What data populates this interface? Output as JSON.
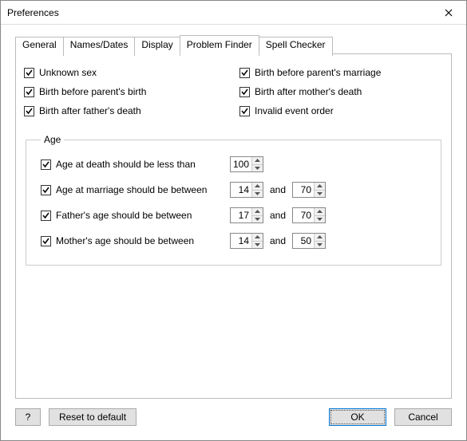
{
  "window": {
    "title": "Preferences"
  },
  "tabs": {
    "general": "General",
    "names_dates": "Names/Dates",
    "display": "Display",
    "problem_finder": "Problem Finder",
    "spell_checker": "Spell Checker"
  },
  "checks": {
    "unknown_sex": "Unknown sex",
    "birth_before_marriage": "Birth before parent's marriage",
    "birth_before_parents_birth": "Birth before parent's birth",
    "birth_after_mothers_death": "Birth after mother's death",
    "birth_after_fathers_death": "Birth after father's death",
    "invalid_event_order": "Invalid event order"
  },
  "age": {
    "legend": "Age",
    "death_label": "Age at death should be less than",
    "death_value": "100",
    "marriage_label": "Age at marriage should be between",
    "marriage_min": "14",
    "marriage_max": "70",
    "father_label": "Father's age should be between",
    "father_min": "17",
    "father_max": "70",
    "mother_label": "Mother's age should be between",
    "mother_min": "14",
    "mother_max": "50",
    "and": "and"
  },
  "footer": {
    "help": "?",
    "reset": "Reset to default",
    "ok": "OK",
    "cancel": "Cancel"
  }
}
